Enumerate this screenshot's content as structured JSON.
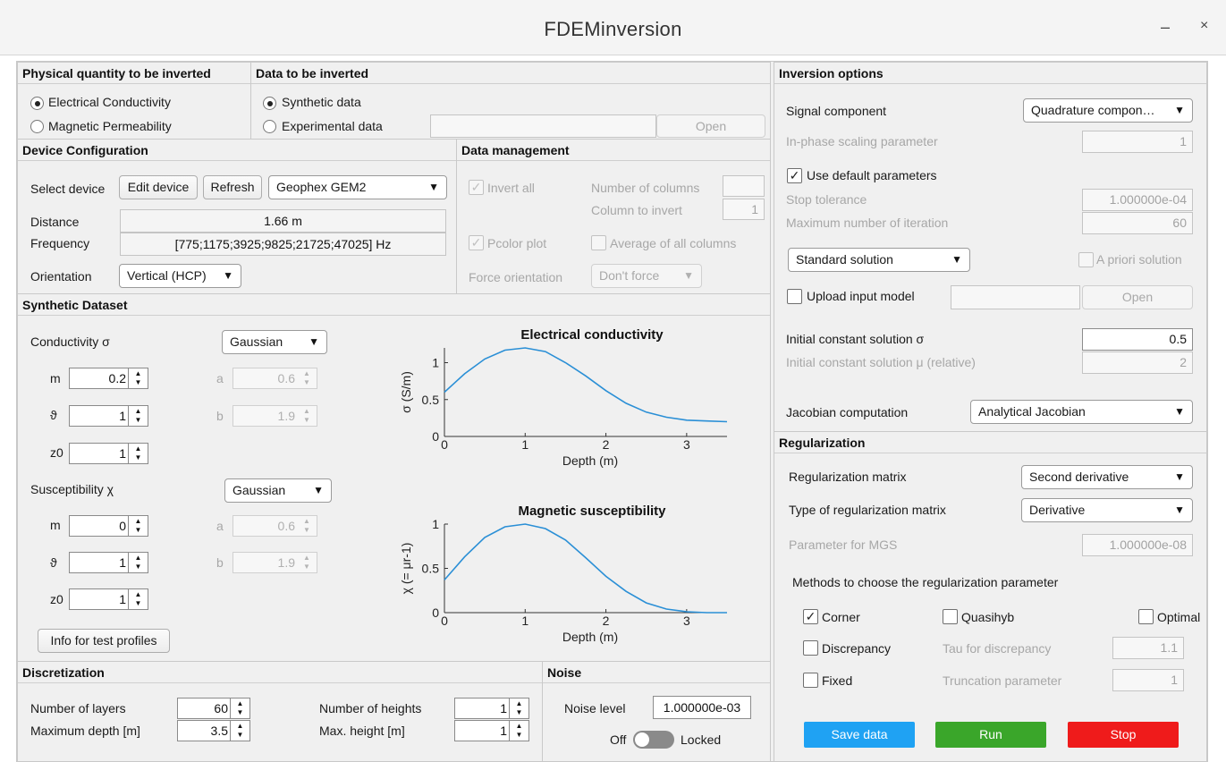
{
  "app": {
    "title": "FDEMinversion",
    "minimize": "–",
    "close": "×"
  },
  "physical": {
    "header": "Physical quantity to be inverted",
    "opt1": "Electrical Conductivity",
    "opt2": "Magnetic Permeability"
  },
  "data_inv": {
    "header": "Data to be inverted",
    "opt1": "Synthetic data",
    "opt2": "Experimental data",
    "open": "Open"
  },
  "device": {
    "header": "Device Configuration",
    "select_label": "Select device",
    "edit": "Edit device",
    "refresh": "Refresh",
    "device": "Geophex GEM2",
    "distance_label": "Distance",
    "distance": "1.66  m",
    "frequency_label": "Frequency",
    "frequency": "[775;1175;3925;9825;21725;47025]  Hz",
    "orientation_label": "Orientation",
    "orientation": "Vertical (HCP)"
  },
  "datamgmt": {
    "header": "Data management",
    "invert_all": "Invert all",
    "ncols_label": "Number of columns",
    "col_label": "Column to invert",
    "col_value": "1",
    "pcolor": "Pcolor plot",
    "average": "Average of all columns",
    "force_label": "Force orientation",
    "force_value": "Don't force"
  },
  "synthetic": {
    "header": "Synthetic Dataset",
    "cond_label": "Conductivity σ",
    "cond_type": "Gaussian",
    "m_label": "m",
    "m_val": "0.2",
    "theta_label": "ϑ",
    "theta_val": "1",
    "z0_label": "z0",
    "z0_val": "1",
    "a_label": "a",
    "a_val": "0.6",
    "b_label": "b",
    "b_val": "1.9",
    "sus_label": "Susceptibility χ",
    "sus_type": "Gaussian",
    "m2_val": "0",
    "theta2_val": "1",
    "z02_val": "1",
    "a2_val": "0.6",
    "b2_val": "1.9",
    "info": "Info for test profiles"
  },
  "chart_data": [
    {
      "type": "line",
      "title": "Electrical conductivity",
      "xlabel": "Depth (m)",
      "ylabel": "σ (S/m)",
      "xlim": [
        0,
        3.5
      ],
      "ylim": [
        0,
        1.2
      ],
      "xticks": [
        "0",
        "1",
        "2",
        "3"
      ],
      "yticks": [
        "0",
        "0.5",
        "1"
      ],
      "series": [
        {
          "color": "#2a8fd6",
          "x": [
            0,
            0.25,
            0.5,
            0.75,
            1,
            1.25,
            1.5,
            1.75,
            2,
            2.25,
            2.5,
            2.75,
            3,
            3.25,
            3.5
          ],
          "y": [
            0.6,
            0.85,
            1.05,
            1.17,
            1.2,
            1.15,
            1.0,
            0.82,
            0.62,
            0.45,
            0.33,
            0.26,
            0.22,
            0.21,
            0.2
          ]
        }
      ]
    },
    {
      "type": "line",
      "title": "Magnetic susceptibility",
      "xlabel": "Depth (m)",
      "ylabel": "χ (= μr-1)",
      "xlim": [
        0,
        3.5
      ],
      "ylim": [
        0,
        1
      ],
      "xticks": [
        "0",
        "1",
        "2",
        "3"
      ],
      "yticks": [
        "0",
        "0.5",
        "1"
      ],
      "series": [
        {
          "color": "#2a8fd6",
          "x": [
            0,
            0.25,
            0.5,
            0.75,
            1,
            1.25,
            1.5,
            1.75,
            2,
            2.25,
            2.5,
            2.75,
            3,
            3.25,
            3.5
          ],
          "y": [
            0.37,
            0.63,
            0.85,
            0.97,
            1.0,
            0.95,
            0.82,
            0.62,
            0.41,
            0.24,
            0.11,
            0.04,
            0.01,
            0.0,
            0.0
          ]
        }
      ]
    }
  ],
  "discretization": {
    "header": "Discretization",
    "layers_label": "Number of layers",
    "layers": "60",
    "maxdepth_label": "Maximum depth [m]",
    "maxdepth": "3.5",
    "heights_label": "Number of heights",
    "heights": "1",
    "maxheight_label": "Max. height [m]",
    "maxheight": "1"
  },
  "noise": {
    "header": "Noise",
    "label": "Noise level",
    "value": "1.000000e-03",
    "off": "Off",
    "locked": "Locked"
  },
  "invopt": {
    "header": "Inversion options",
    "signal_label": "Signal component",
    "signal": "Quadrature compon…",
    "inphase_label": "In-phase scaling parameter",
    "inphase": "1",
    "default_params": "Use default parameters",
    "stoptol_label": "Stop tolerance",
    "stoptol": "1.000000e-04",
    "maxiter_label": "Maximum number of iteration",
    "maxiter": "60",
    "solution": "Standard solution",
    "apriori": "A priori solution",
    "upload": "Upload input model",
    "open": "Open",
    "init_sigma_label": "Initial constant solution σ",
    "init_sigma": "0.5",
    "init_mu_label": "Initial constant solution μ (relative)",
    "init_mu": "2",
    "jac_label": "Jacobian computation",
    "jac": "Analytical Jacobian"
  },
  "reg": {
    "header": "Regularization",
    "matrix_label": "Regularization matrix",
    "matrix": "Second derivative",
    "type_label": "Type of regularization matrix",
    "type": "Derivative",
    "mgs_label": "Parameter for MGS",
    "mgs": "1.000000e-08",
    "methods_label": "Methods to choose the regularization parameter",
    "corner": "Corner",
    "quasihyb": "Quasihyb",
    "optimal": "Optimal",
    "discrepancy": "Discrepancy",
    "tau_label": "Tau for discrepancy",
    "tau": "1.1",
    "fixed": "Fixed",
    "trunc_label": "Truncation parameter",
    "trunc": "1"
  },
  "actions": {
    "save": "Save data",
    "run": "Run",
    "stop": "Stop",
    "save_color": "#1fa2f3",
    "run_color": "#3aa62a",
    "stop_color": "#ef1b1b"
  }
}
